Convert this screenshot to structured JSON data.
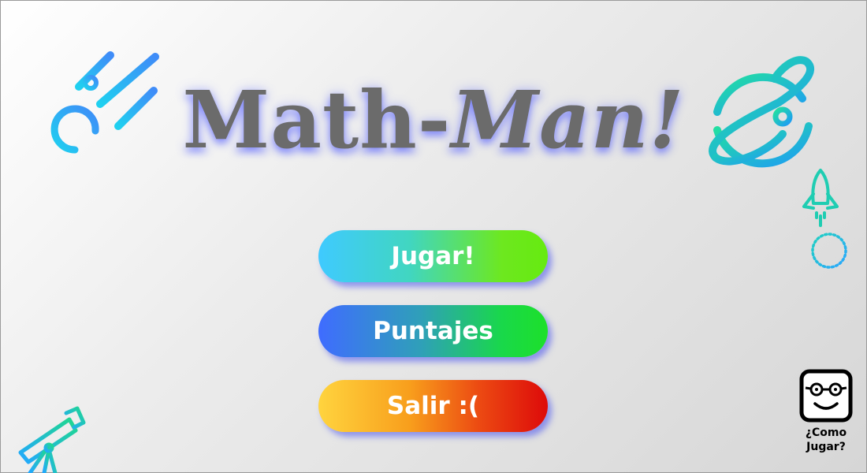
{
  "title": {
    "part1": "Math-",
    "part2": "Man!"
  },
  "menu": {
    "play_label": "Jugar!",
    "scores_label": "Puntajes",
    "exit_label": "Salir :("
  },
  "help": {
    "line1": "¿Como",
    "line2": "Jugar?"
  },
  "icons": {
    "meteor": "meteor-icon",
    "planet": "planet-icon",
    "rocket": "rocket-icon",
    "ring": "dotted-ring-icon",
    "telescope": "telescope-icon",
    "help_face": "nerd-face-icon"
  },
  "colors": {
    "title": "#6b6b6b",
    "title_glow": "#4650ff",
    "play_start": "#3fcaff",
    "play_end": "#66ea10",
    "scores_start": "#3f6cff",
    "scores_end": "#1de02a",
    "exit_start": "#ffd43e",
    "exit_end": "#dd0a0a"
  }
}
